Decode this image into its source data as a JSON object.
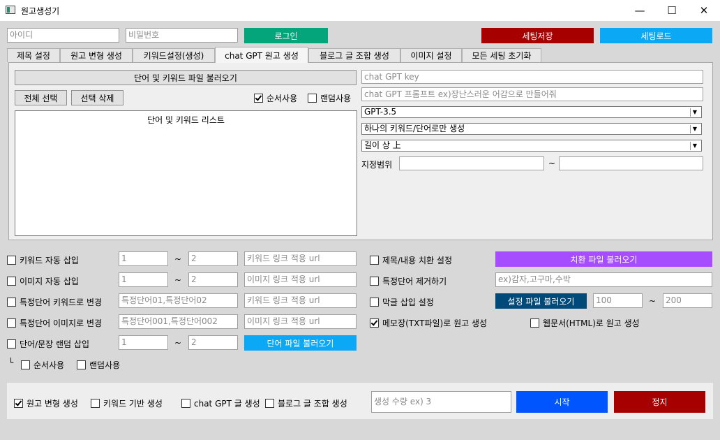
{
  "window": {
    "title": "원고생성기",
    "minimize": "—",
    "maximize": "☐",
    "close": "✕"
  },
  "login": {
    "id_placeholder": "아이디",
    "pw_placeholder": "비밀번호",
    "login_button": "로그인",
    "save_settings_button": "세팅저장",
    "load_settings_button": "세팅로드"
  },
  "tabs": [
    {
      "label": "제목 설정"
    },
    {
      "label": "원고 변형 생성"
    },
    {
      "label": "키워드설정(생성)"
    },
    {
      "label": "chat GPT 원고 생성"
    },
    {
      "label": "블로그 글 조합 생성"
    },
    {
      "label": "이미지 설정"
    },
    {
      "label": "모든 세팅 초기화"
    }
  ],
  "gpt_tab": {
    "load_file_button": "단어 및 키워드 파일 불러오기",
    "select_all_button": "전체 선택",
    "delete_selected_button": "선택 삭제",
    "sequential_label": "순서사용",
    "random_label": "랜덤사용",
    "list_header": "단어 및 키워드 리스트",
    "gpt_key_placeholder": "chat GPT key",
    "gpt_prompt_placeholder": "chat GPT 프롬프트 ex)장난스러운 어감으로 만들어줘",
    "model_value": "GPT-3.5",
    "keyword_mode_value": "하나의 키워드/단어로만 생성",
    "length_value": "길이 상 上",
    "range_label": "지정범위",
    "tilde": "~"
  },
  "options": {
    "kw_auto_insert": {
      "label": "키워드 자동 삽입",
      "from": "1",
      "to": "2",
      "url_placeholder": "키워드 링크 적용 url"
    },
    "img_auto_insert": {
      "label": "이미지 자동 삽입",
      "from": "1",
      "to": "2",
      "url_placeholder": "이미지 링크 적용 url"
    },
    "word_to_kw": {
      "label": "특정단어 키워드로 변경",
      "words_placeholder": "특정단어01,특정단어02",
      "url_placeholder": "키워드 링크 적용 url"
    },
    "word_to_img": {
      "label": "특정단어 이미지로 변경",
      "words_placeholder": "특정단어001,특정단어002",
      "url_placeholder": "이미지 링크 적용 url"
    },
    "random_insert": {
      "label": "단어/문장 랜덤 삽입",
      "from": "1",
      "to": "2",
      "load_button": "단어 파일 불러오기"
    },
    "sub_prefix": "└",
    "sub_sequential": "순서사용",
    "sub_random": "랜덤사용",
    "title_replace": {
      "label": "제목/내용 치환 설정",
      "load_button": "치환 파일 불러오기"
    },
    "remove_words": {
      "label": "특정단어 제거하기",
      "placeholder": "ex)감자,고구마,수박"
    },
    "random_insert_setting": {
      "label": "막글 삽입 설정",
      "load_button": "설정 파일 불러오기",
      "from": "100",
      "to": "200"
    },
    "notepad_output": {
      "label": "메모장(TXT파일)로 원고 생성"
    },
    "html_output": {
      "label": "웹문서(HTML)로 원고 생성"
    },
    "tilde": "~"
  },
  "bottom": {
    "modify_gen": "원고 변형 생성",
    "keyword_gen": "키워드 기반 생성",
    "gpt_gen": "chat GPT 글 생성",
    "blog_gen": "블로그 글 조합 생성",
    "count_placeholder": "생성 수량 ex) 3",
    "start_button": "시작",
    "stop_button": "정지"
  },
  "colors": {
    "login_green": "#05a57b",
    "save_red": "#a60000",
    "load_blue": "#0aa8f5",
    "purple": "#a64dff",
    "dark_blue": "#004a7a",
    "start_blue": "#0055ff",
    "stop_red": "#a60000",
    "word_file_blue": "#0aa8f5"
  }
}
